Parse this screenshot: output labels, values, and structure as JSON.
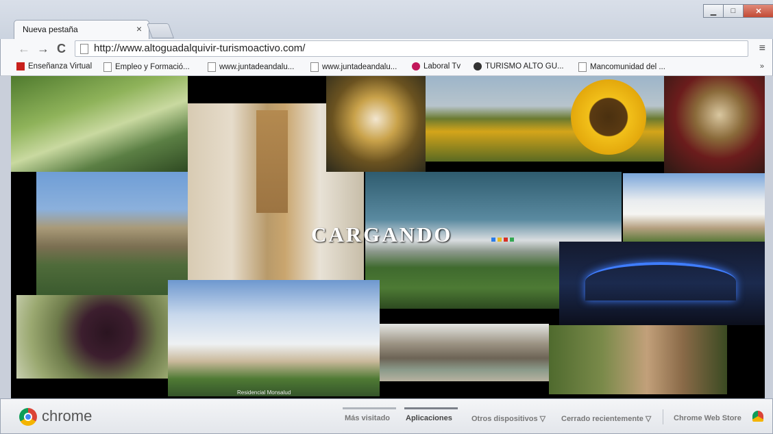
{
  "window": {
    "minimize_icon": "minimize-icon",
    "maximize_icon": "maximize-icon",
    "close_icon": "close-icon"
  },
  "tabs": [
    {
      "title": "Nueva pestaña",
      "close": "×"
    }
  ],
  "toolbar": {
    "back": "←",
    "forward": "→",
    "reload": "C",
    "url": "http://www.altoguadalquivir-turismoactivo.com/",
    "menu": "≡"
  },
  "bookmarks": [
    {
      "label": "Enseñanza Virtual",
      "icon": "red-square-icon"
    },
    {
      "label": "Empleo y Formació...",
      "icon": "page-icon"
    },
    {
      "label": "www.juntadeandalu...",
      "icon": "page-icon"
    },
    {
      "label": "www.juntadeandalu...",
      "icon": "page-icon"
    },
    {
      "label": "Laboral Tv",
      "icon": "laboral-tv-icon"
    },
    {
      "label": "TURISMO ALTO GU...",
      "icon": "turismo-icon"
    },
    {
      "label": "Mancomunidad del ...",
      "icon": "page-icon"
    }
  ],
  "bookmarks_more": "»",
  "content": {
    "loading_text": "CARGANDO",
    "caption": "Residencial Monsalud",
    "dot_colors": [
      "#2b7de9",
      "#e8b923",
      "#d93025",
      "#34a853"
    ]
  },
  "bottom": {
    "brand": "chrome",
    "nav": [
      {
        "label": "Más visitado",
        "active": false
      },
      {
        "label": "Aplicaciones",
        "active": true
      },
      {
        "label": "Otros dispositivos ▽",
        "active": false
      },
      {
        "label": "Cerrado recientemente ▽",
        "active": false
      },
      {
        "label": "Chrome Web Store",
        "active": false
      }
    ]
  },
  "colors": {
    "frame": "#cbd3df",
    "toolbar": "#f7f8fa",
    "close_button": "#c24a35"
  }
}
